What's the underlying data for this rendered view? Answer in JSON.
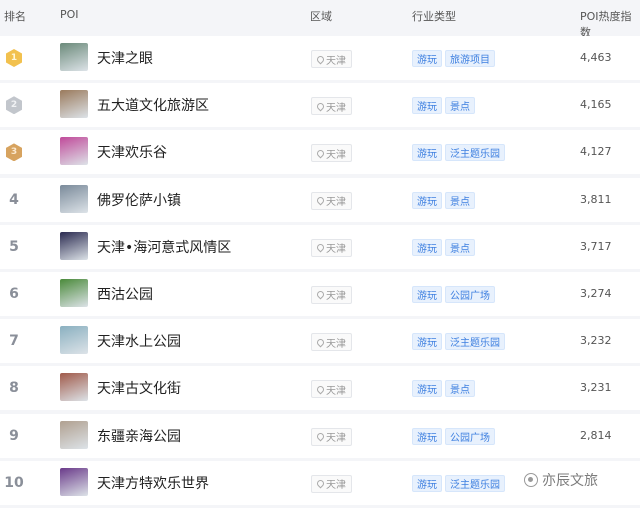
{
  "table": {
    "headers": {
      "rank": "排名",
      "poi": "POI",
      "area": "区域",
      "industry": "行业类型",
      "heat": "POI热度指数"
    },
    "rows": [
      {
        "rank": "1",
        "medal": "gold",
        "name": "天津之眼",
        "area": "天津",
        "tags": [
          "游玩",
          "旅游项目"
        ],
        "heat": "4,463",
        "thumb": "#6b8a7a"
      },
      {
        "rank": "2",
        "medal": "silver",
        "name": "五大道文化旅游区",
        "area": "天津",
        "tags": [
          "游玩",
          "景点"
        ],
        "heat": "4,165",
        "thumb": "#9a7a5c"
      },
      {
        "rank": "3",
        "medal": "bronze",
        "name": "天津欢乐谷",
        "area": "天津",
        "tags": [
          "游玩",
          "泛主题乐园"
        ],
        "heat": "4,127",
        "thumb": "#c04a9a"
      },
      {
        "rank": "4",
        "medal": "",
        "name": "佛罗伦萨小镇",
        "area": "天津",
        "tags": [
          "游玩",
          "景点"
        ],
        "heat": "3,811",
        "thumb": "#7a8a9a"
      },
      {
        "rank": "5",
        "medal": "",
        "name": "天津•海河意式风情区",
        "area": "天津",
        "tags": [
          "游玩",
          "景点"
        ],
        "heat": "3,717",
        "thumb": "#2a2a50"
      },
      {
        "rank": "6",
        "medal": "",
        "name": "西沽公园",
        "area": "天津",
        "tags": [
          "游玩",
          "公园广场"
        ],
        "heat": "3,274",
        "thumb": "#4a8a3a"
      },
      {
        "rank": "7",
        "medal": "",
        "name": "天津水上公园",
        "area": "天津",
        "tags": [
          "游玩",
          "泛主题乐园"
        ],
        "heat": "3,232",
        "thumb": "#8ab0c0"
      },
      {
        "rank": "8",
        "medal": "",
        "name": "天津古文化街",
        "area": "天津",
        "tags": [
          "游玩",
          "景点"
        ],
        "heat": "3,231",
        "thumb": "#a05a4a"
      },
      {
        "rank": "9",
        "medal": "",
        "name": "东疆亲海公园",
        "area": "天津",
        "tags": [
          "游玩",
          "公园广场"
        ],
        "heat": "2,814",
        "thumb": "#b0a090"
      },
      {
        "rank": "10",
        "medal": "",
        "name": "天津方特欢乐世界",
        "area": "天津",
        "tags": [
          "游玩",
          "泛主题乐园"
        ],
        "heat": "",
        "thumb": "#6a3a8a"
      }
    ]
  },
  "watermark": "亦辰文旅"
}
